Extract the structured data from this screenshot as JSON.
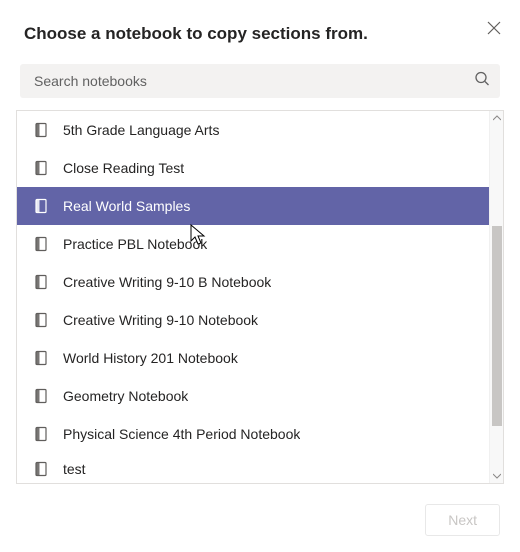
{
  "title": "Choose a notebook to copy sections from.",
  "search": {
    "placeholder": "Search notebooks"
  },
  "items": [
    {
      "label": "5th Grade Language Arts",
      "selected": false
    },
    {
      "label": "Close Reading Test",
      "selected": false
    },
    {
      "label": "Real World Samples",
      "selected": true
    },
    {
      "label": "Practice PBL Notebook",
      "selected": false
    },
    {
      "label": "Creative Writing 9-10 B Notebook",
      "selected": false
    },
    {
      "label": "Creative Writing 9-10 Notebook",
      "selected": false
    },
    {
      "label": "World History 201 Notebook",
      "selected": false
    },
    {
      "label": "Geometry Notebook",
      "selected": false
    },
    {
      "label": "Physical Science 4th Period Notebook",
      "selected": false
    },
    {
      "label": "test",
      "selected": false,
      "cutoff": true
    }
  ],
  "footer": {
    "next_label": "Next"
  }
}
